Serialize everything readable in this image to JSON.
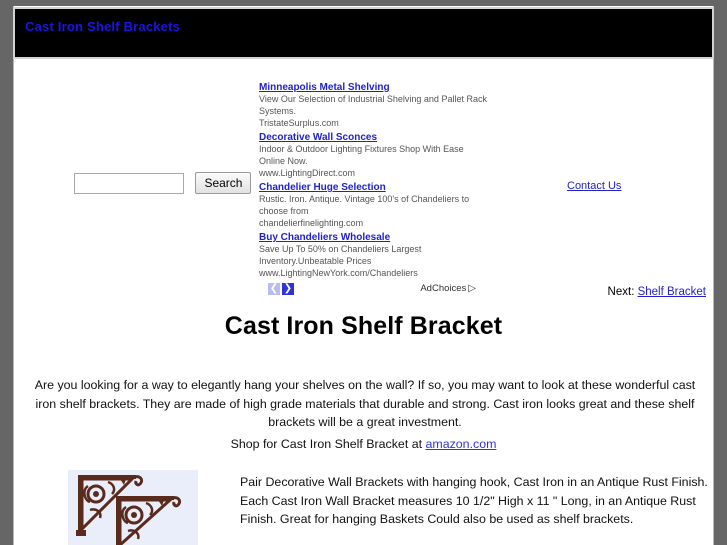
{
  "banner": {
    "title": "Cast Iron Shelf Brackets",
    "text_color": "#1a14e6",
    "background": "#000000"
  },
  "search": {
    "value": "",
    "placeholder": "",
    "button_label": "Search"
  },
  "ads": {
    "items": [
      {
        "title": "Minneapolis Metal Shelving",
        "description": "View Our Selection of Industrial Shelving and Pallet Rack Systems.",
        "url": "TristateSurplus.com"
      },
      {
        "title": "Decorative Wall Sconces",
        "description": "Indoor & Outdoor Lighting Fixtures Shop With Ease Online Now.",
        "url": "www.LightingDirect.com"
      },
      {
        "title": "Chandelier Huge Selection",
        "description": "Rustic. Iron. Antique. Vintage 100's of Chandeliers to choose from",
        "url": "chandelierfinelighting.com"
      },
      {
        "title": "Buy Chandeliers Wholesale",
        "description": "Save Up To 50% on Chandeliers Largest Inventory.Unbeatable Prices",
        "url": "www.LightingNewYork.com/Chandeliers"
      }
    ],
    "prev_arrow": "❮",
    "next_arrow": "❯",
    "adchoices_label": "AdChoices",
    "adchoices_icon": "▷",
    "prev_color": "#b9bcee",
    "next_color": "#2d35d8"
  },
  "contact": {
    "label": "Contact Us"
  },
  "next_nav": {
    "prefix": "Next: ",
    "link_label": "Shelf Bracket"
  },
  "main": {
    "heading": "Cast Iron Shelf Bracket",
    "intro": "Are you looking for a way to elegantly hang your shelves on the wall? If so, you may want to look at these wonderful cast iron shelf brackets. They are made of high grade materials that durable and strong. Cast iron looks great and these shelf brackets will be a great investment.",
    "shop_prefix": "Shop for Cast Iron Shelf Bracket at ",
    "shop_link_label": "amazon.com",
    "product_description": "Pair Decorative Wall Brackets with hanging hook, Cast Iron in an Antique Rust Finish. Each Cast Iron Wall Bracket measures 10 1/2\" High x 11 \" Long, in an Antique Rust Finish. Great for hanging Baskets Could also be used as shelf brackets."
  },
  "colors": {
    "link": "#2222cc",
    "page_background": "#666666",
    "content_background": "#ffffff"
  }
}
